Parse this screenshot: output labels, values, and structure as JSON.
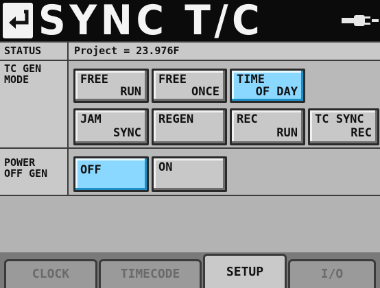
{
  "header": {
    "title": "SYNC T/C",
    "back_icon": "return-arrow-icon",
    "power_icon": "power-plug-icon"
  },
  "status": {
    "label": "STATUS",
    "value": "Project = 23.976F"
  },
  "tc_gen_mode": {
    "label_line1": "TC GEN",
    "label_line2": "MODE",
    "buttons": [
      {
        "line1": "FREE",
        "line2": "RUN",
        "selected": false
      },
      {
        "line1": "FREE",
        "line2": "ONCE",
        "selected": false
      },
      {
        "line1": "TIME",
        "line2": "OF DAY",
        "selected": true
      },
      {
        "line1": "JAM",
        "line2": "SYNC",
        "selected": false
      },
      {
        "line1": "REGEN",
        "line2": "",
        "selected": false
      },
      {
        "line1": "REC",
        "line2": "RUN",
        "selected": false
      },
      {
        "line1": "TC SYNC",
        "line2": "REC",
        "selected": false
      }
    ]
  },
  "power_off_gen": {
    "label_line1": "POWER",
    "label_line2": "OFF GEN",
    "buttons": [
      {
        "label": "OFF",
        "selected": true
      },
      {
        "label": "ON",
        "selected": false
      }
    ]
  },
  "tabs": [
    {
      "label": "CLOCK",
      "active": false
    },
    {
      "label": "TIMECODE",
      "active": false
    },
    {
      "label": "SETUP",
      "active": true
    },
    {
      "label": "I/O",
      "active": false
    }
  ],
  "colors": {
    "selected": "#8ad8ff",
    "button": "#c8c8c8",
    "header_bg": "#0b0b0b",
    "panel": "#b9b9b9"
  }
}
